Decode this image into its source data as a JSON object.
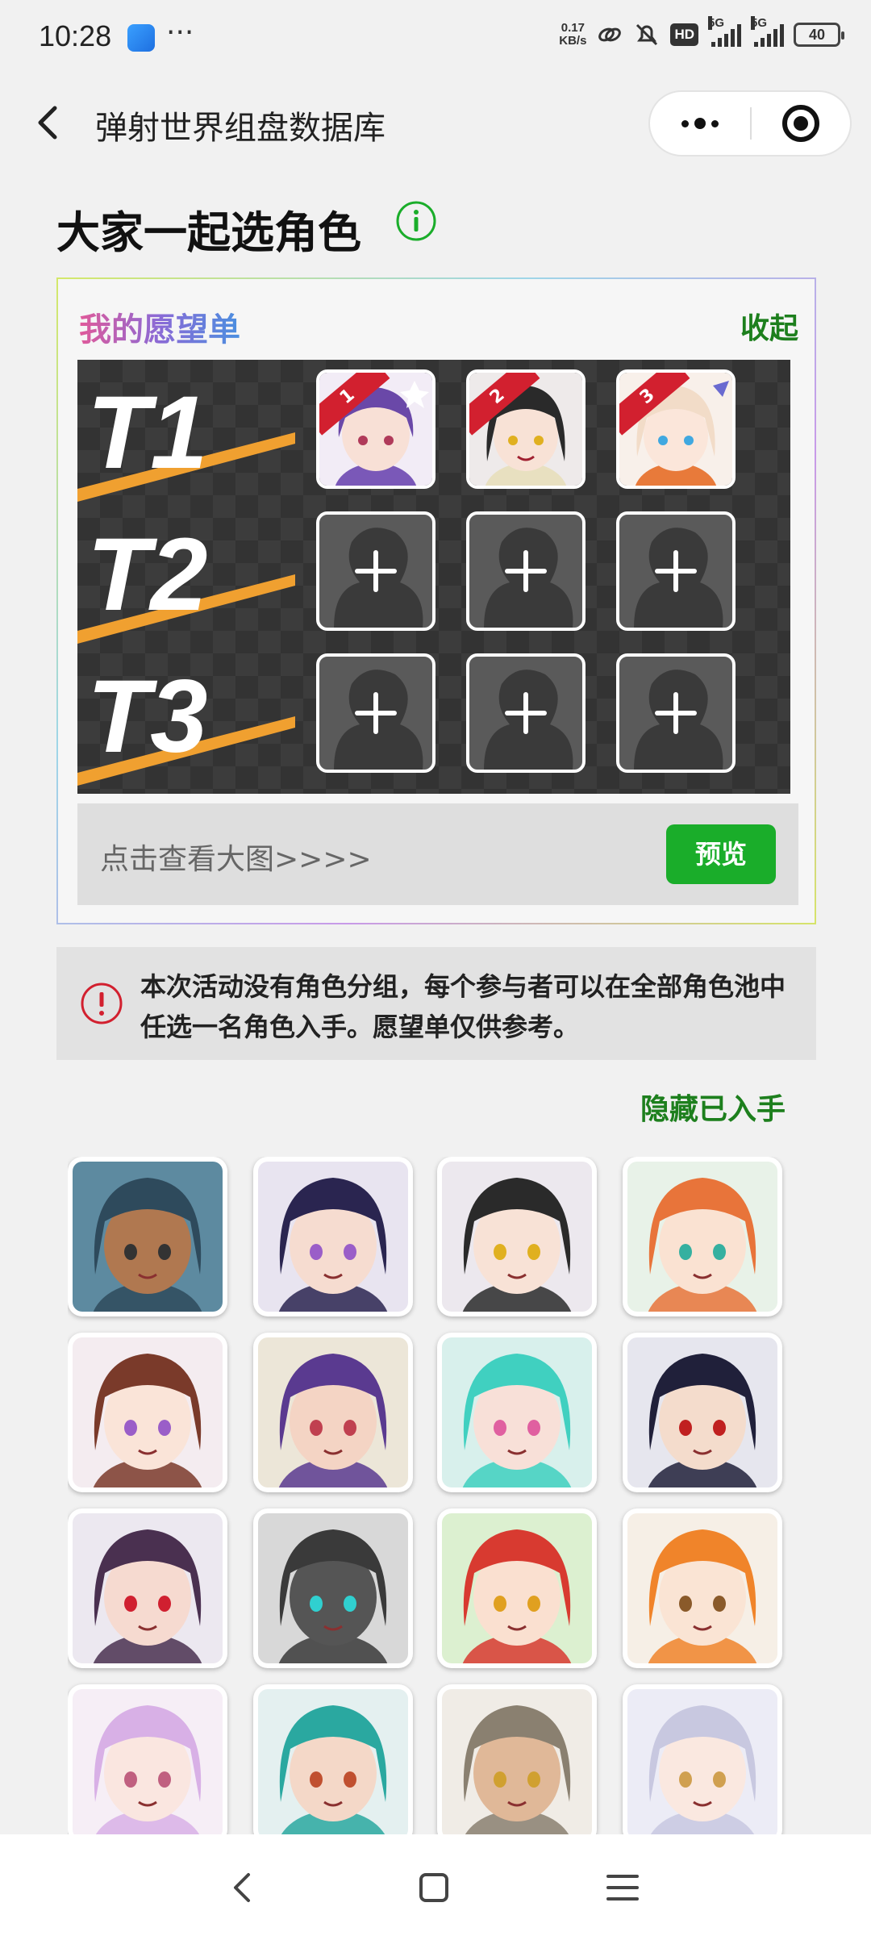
{
  "status_bar": {
    "time": "10:28",
    "dots": "···",
    "net_speed_value": "0.17",
    "net_speed_unit": "KB/s",
    "hd_label": "HD",
    "sig1_label": "5G",
    "sig2_label": "5G",
    "battery": "40"
  },
  "nav": {
    "title": "弹射世界组盘数据库"
  },
  "page": {
    "title": "大家一起选角色"
  },
  "wishlist": {
    "title": "我的愿望单",
    "collapse_label": "收起",
    "tiers": [
      {
        "label": "T1",
        "slots": [
          {
            "rank": "1",
            "filled": true,
            "portrait": "purple-hair-girl"
          },
          {
            "rank": "2",
            "filled": true,
            "portrait": "black-hair-girl"
          },
          {
            "rank": "3",
            "filled": true,
            "portrait": "blonde-girl"
          }
        ]
      },
      {
        "label": "T2",
        "slots": [
          {
            "filled": false
          },
          {
            "filled": false
          },
          {
            "filled": false
          }
        ]
      },
      {
        "label": "T3",
        "slots": [
          {
            "filled": false
          },
          {
            "filled": false
          },
          {
            "filled": false
          }
        ]
      }
    ],
    "preview_hint": "点击查看大图>>>>",
    "preview_button": "预览"
  },
  "notice": {
    "text": "本次活动没有角色分组，每个参与者可以在全部角色池中任选一名角色入手。愿望单仅供参考。"
  },
  "hide_owned_label": "隐藏已入手",
  "characters": [
    {
      "name": "pirate-captain",
      "bg": "#5d8aa0",
      "hair": "#2e4a5c",
      "skin": "#b07850",
      "eye": "#333333"
    },
    {
      "name": "navy-hair-girl",
      "bg": "#e8e4f0",
      "hair": "#2a2550",
      "skin": "#f6dcd0",
      "eye": "#9a5ec8"
    },
    {
      "name": "black-hair-fang-girl",
      "bg": "#ece8ee",
      "hair": "#2a2a2a",
      "skin": "#f8e2d6",
      "eye": "#e0b020"
    },
    {
      "name": "orange-hair-girl",
      "bg": "#e8f2e8",
      "hair": "#e8743a",
      "skin": "#fae2d2",
      "eye": "#35b0a0"
    },
    {
      "name": "horse-girl",
      "bg": "#f4ecf0",
      "hair": "#7a3a2a",
      "skin": "#fae4d8",
      "eye": "#9a5ec8"
    },
    {
      "name": "purple-hair-woman",
      "bg": "#ece6d8",
      "hair": "#5a3a90",
      "skin": "#f4d4c4",
      "eye": "#c04050"
    },
    {
      "name": "teal-hair-girl",
      "bg": "#d8f0ec",
      "hair": "#40d0c0",
      "skin": "#f8e0d8",
      "eye": "#e060a0"
    },
    {
      "name": "red-black-hair-boy",
      "bg": "#e6e6ee",
      "hair": "#20203a",
      "skin": "#f4dccc",
      "eye": "#c02020"
    },
    {
      "name": "demon-horn-girl",
      "bg": "#ece8f0",
      "hair": "#4a3050",
      "skin": "#f6dad0",
      "eye": "#d02030"
    },
    {
      "name": "armored-robot",
      "bg": "#d8d8d8",
      "hair": "#3a3a3a",
      "skin": "#555555",
      "eye": "#30d0d0"
    },
    {
      "name": "red-hat-girl",
      "bg": "#dcf0d0",
      "hair": "#d83a30",
      "skin": "#fae0d0",
      "eye": "#e0a020"
    },
    {
      "name": "orange-hair-winking-girl",
      "bg": "#f6efe6",
      "hair": "#f0842a",
      "skin": "#fae4d4",
      "eye": "#8a5a2a"
    },
    {
      "name": "lilac-hair-girl",
      "bg": "#f6eef6",
      "hair": "#d8b0e6",
      "skin": "#fae6e0",
      "eye": "#c06080"
    },
    {
      "name": "cyan-hair-boy",
      "bg": "#e4f0f0",
      "hair": "#2aa8a0",
      "skin": "#f4d8c8",
      "eye": "#c05030"
    },
    {
      "name": "grey-hair-man",
      "bg": "#f0ece6",
      "hair": "#8a8070",
      "skin": "#e0b898",
      "eye": "#d0a030"
    },
    {
      "name": "silver-hair-girl",
      "bg": "#ececf6",
      "hair": "#c8c8e0",
      "skin": "#fae8e0",
      "eye": "#d0a050"
    }
  ],
  "colors": {
    "accent_green": "#1aad2a",
    "link_green": "#1d7f1d",
    "notice_red": "#d2202f",
    "tier_orange": "#f0a030"
  }
}
